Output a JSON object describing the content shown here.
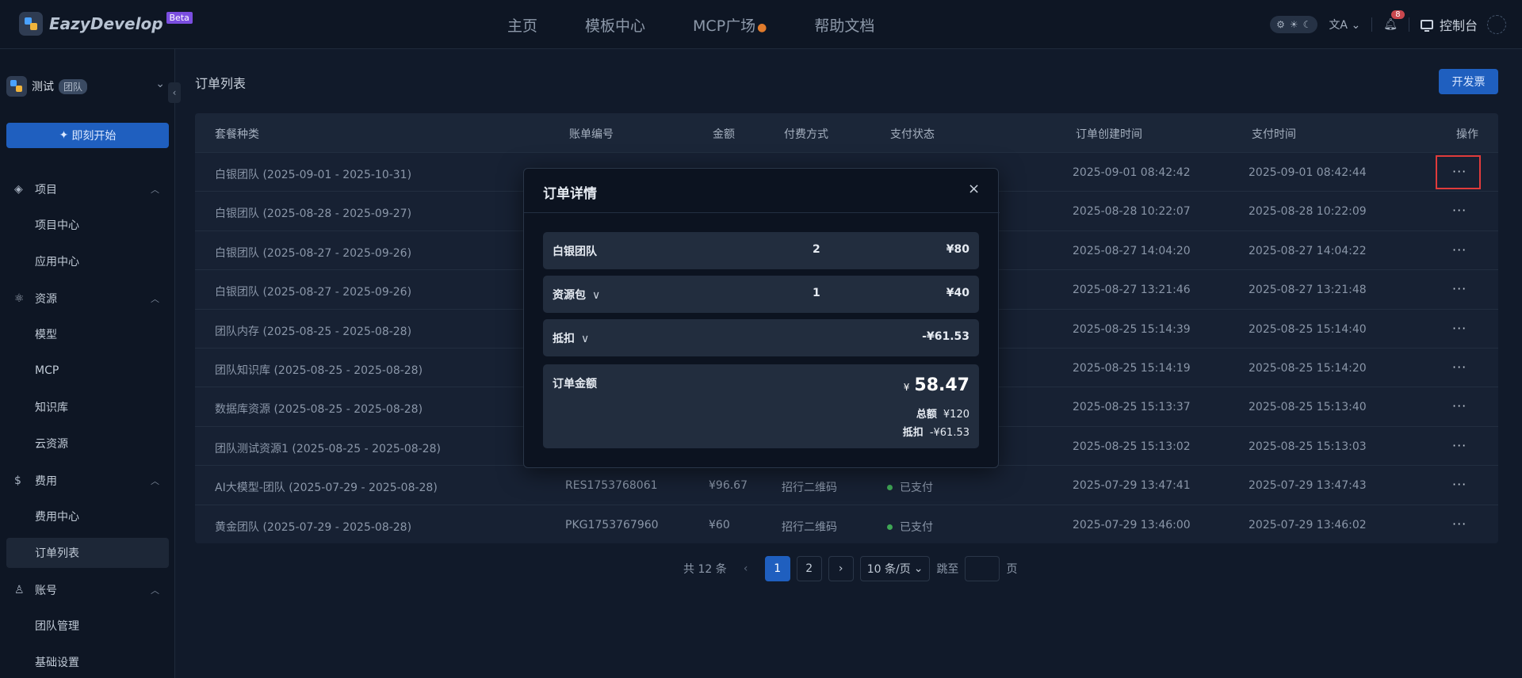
{
  "brand": {
    "name": "EazyDevelop",
    "badge": "Beta"
  },
  "nav": {
    "items": [
      "主页",
      "模板中心",
      "MCP广场",
      "帮助文档"
    ]
  },
  "topbar": {
    "console": "控制台",
    "notifications": "8",
    "theme_icons": [
      "⚙",
      "☀",
      "☾"
    ]
  },
  "sidebar": {
    "team_name": "测试",
    "team_tag": "团队",
    "start_button": "即刻开始",
    "groups": [
      {
        "label": "项目",
        "icon": "layers-icon",
        "items": [
          "项目中心",
          "应用中心"
        ]
      },
      {
        "label": "资源",
        "icon": "atom-icon",
        "items": [
          "模型",
          "MCP",
          "知识库",
          "云资源"
        ]
      },
      {
        "label": "费用",
        "icon": "dollar-icon",
        "items": [
          "费用中心",
          "订单列表"
        ]
      },
      {
        "label": "账号",
        "icon": "user-icon",
        "items": [
          "团队管理",
          "基础设置"
        ]
      }
    ],
    "active_item": "订单列表"
  },
  "page": {
    "title": "订单列表",
    "invoice_button": "开发票"
  },
  "table": {
    "headers": [
      "套餐种类",
      "账单编号",
      "金额",
      "付费方式",
      "支付状态",
      "订单创建时间",
      "支付时间",
      "操作"
    ],
    "rows": [
      {
        "pkg": "白银团队 (2025-09-01 - 2025-10-31)",
        "id": "",
        "amount": "",
        "method": "",
        "status": "",
        "created": "2025-09-01 08:42:42",
        "paid": "2025-09-01 08:42:44"
      },
      {
        "pkg": "白银团队 (2025-08-28 - 2025-09-27)",
        "id": "",
        "amount": "",
        "method": "",
        "status": "",
        "created": "2025-08-28 10:22:07",
        "paid": "2025-08-28 10:22:09"
      },
      {
        "pkg": "白银团队 (2025-08-27 - 2025-09-26)",
        "id": "",
        "amount": "",
        "method": "",
        "status": "",
        "created": "2025-08-27 14:04:20",
        "paid": "2025-08-27 14:04:22"
      },
      {
        "pkg": "白银团队 (2025-08-27 - 2025-09-26)",
        "id": "",
        "amount": "",
        "method": "",
        "status": "",
        "created": "2025-08-27 13:21:46",
        "paid": "2025-08-27 13:21:48"
      },
      {
        "pkg": "团队内存 (2025-08-25 - 2025-08-28)",
        "id": "",
        "amount": "",
        "method": "",
        "status": "",
        "created": "2025-08-25 15:14:39",
        "paid": "2025-08-25 15:14:40"
      },
      {
        "pkg": "团队知识库 (2025-08-25 - 2025-08-28)",
        "id": "",
        "amount": "",
        "method": "",
        "status": "",
        "created": "2025-08-25 15:14:19",
        "paid": "2025-08-25 15:14:20"
      },
      {
        "pkg": "数据库资源 (2025-08-25 - 2025-08-28)",
        "id": "",
        "amount": "",
        "method": "",
        "status": "",
        "created": "2025-08-25 15:13:37",
        "paid": "2025-08-25 15:13:40"
      },
      {
        "pkg": "团队测试资源1 (2025-08-25 - 2025-08-28)",
        "id": "",
        "amount": "",
        "method": "",
        "status": "",
        "created": "2025-08-25 15:13:02",
        "paid": "2025-08-25 15:13:03"
      },
      {
        "pkg": "AI大模型-团队 (2025-07-29 - 2025-08-28)",
        "id": "RES1753768061",
        "amount": "¥96.67",
        "method": "招行二维码",
        "status": "已支付",
        "created": "2025-07-29 13:47:41",
        "paid": "2025-07-29 13:47:43"
      },
      {
        "pkg": "黄金团队 (2025-07-29 - 2025-08-28)",
        "id": "PKG1753767960",
        "amount": "¥60",
        "method": "招行二维码",
        "status": "已支付",
        "created": "2025-07-29 13:46:00",
        "paid": "2025-07-29 13:46:02"
      }
    ],
    "action_glyph": "···"
  },
  "pagination": {
    "total": "共 12 条",
    "prev": "‹",
    "pages": [
      "1",
      "2"
    ],
    "next": "›",
    "size": "10 条/页",
    "jump_label": "跳至",
    "page_unit": "页"
  },
  "modal": {
    "title": "订单详情",
    "close": "×",
    "items": [
      {
        "name": "白银团队",
        "qty": "2",
        "price": "¥80"
      },
      {
        "name": "资源包",
        "qty": "1",
        "price": "¥40"
      }
    ],
    "deduction": {
      "name": "抵扣",
      "price": "-¥61.53"
    },
    "order_amount": {
      "label": "订单金额",
      "currency": "¥",
      "value": "58.47"
    },
    "summary": {
      "total_label": "总额",
      "total": "¥120",
      "deduct_label": "抵扣",
      "deduct": "-¥61.53"
    }
  }
}
